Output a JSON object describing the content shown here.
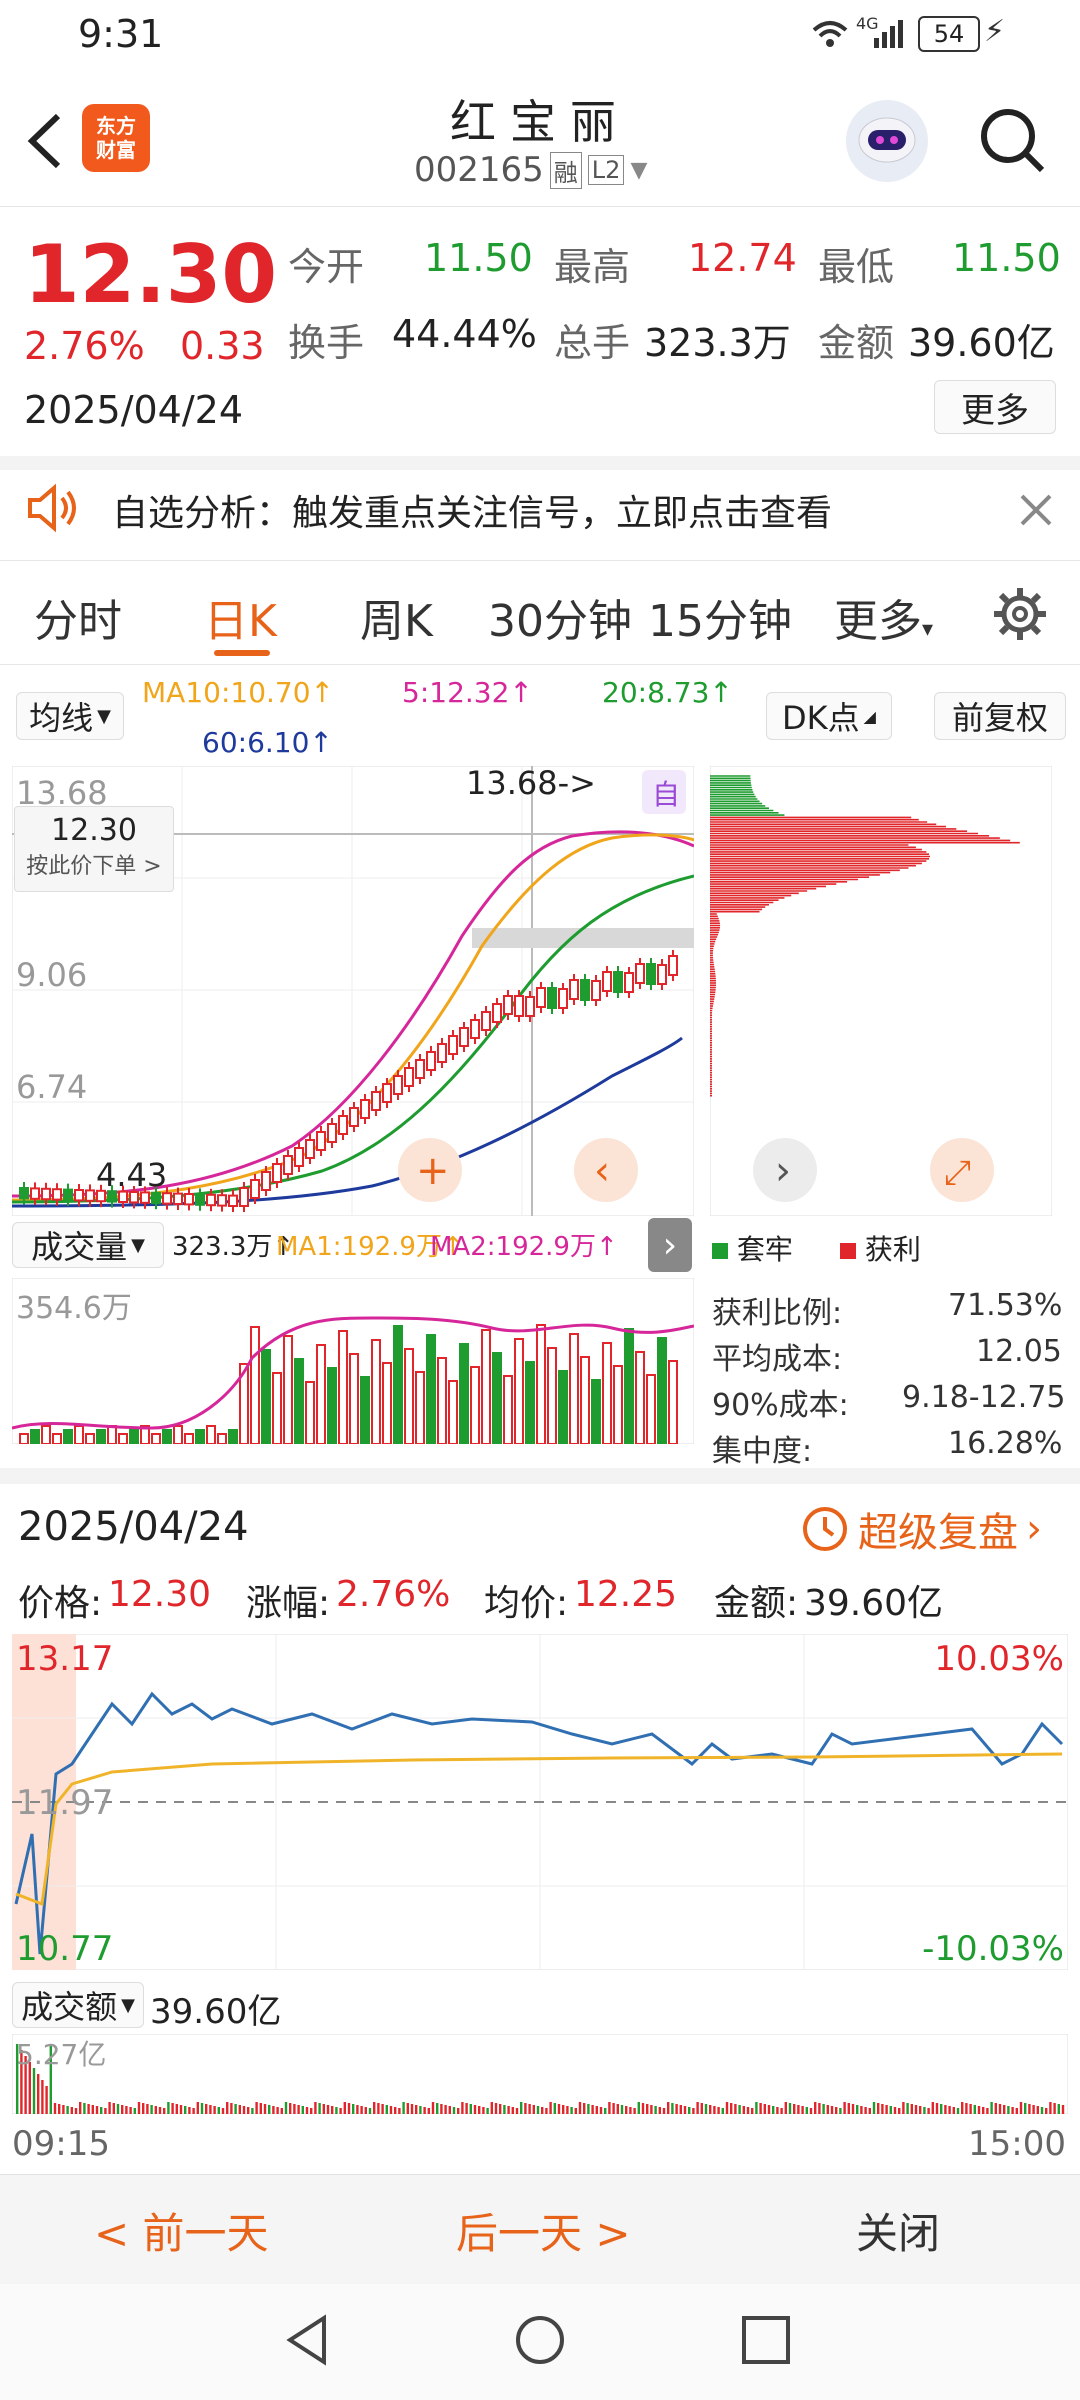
{
  "status_bar": {
    "time": "9:31",
    "network": "4G",
    "battery": "54"
  },
  "header": {
    "title": "红宝丽",
    "code": "002165",
    "badge_margin": "融",
    "badge_level": "L2",
    "logo_line1": "东方",
    "logo_line2": "财富"
  },
  "quote": {
    "price": "12.30",
    "change_pct": "2.76%",
    "change": "0.33",
    "date": "2025/04/24",
    "open_label": "今开",
    "open": "11.50",
    "high_label": "最高",
    "high": "12.74",
    "low_label": "最低",
    "low": "11.50",
    "turnover_label": "换手",
    "turnover": "44.44%",
    "volume_label": "总手",
    "volume": "323.3万",
    "amount_label": "金额",
    "amount": "39.60亿",
    "more_label": "更多"
  },
  "banner": {
    "text": "自选分析：触发重点关注信号，立即点击查看"
  },
  "tabs": [
    {
      "label": "分时"
    },
    {
      "label": "日K"
    },
    {
      "label": "周K"
    },
    {
      "label": "30分钟"
    },
    {
      "label": "15分钟"
    },
    {
      "label": "更多"
    }
  ],
  "kline": {
    "ma_selector": "均线",
    "ma10": "MA10:10.70↑",
    "ma5": "5:12.32↑",
    "ma20": "20:8.73↑",
    "ma60": "60:6.10↑",
    "dk_label": "DK点",
    "adjust_label": "前复权",
    "price_labels": [
      "13.68",
      "9.06",
      "6.74"
    ],
    "low_marker": "4.43",
    "high_marker": "13.68->",
    "self_tag": "自",
    "crosshair_price": "12.30",
    "crosshair_action": "按此价下单 >",
    "vol_selector": "成交量",
    "vol_value": "323.3万↑",
    "vol_ma1": "MA1:192.9万↑",
    "vol_ma2": "MA2:192.9万↑",
    "vol_max": "354.6万",
    "colors": {
      "up": "#e0262b",
      "down": "#1e9c2f",
      "ma5": "#d6279a",
      "ma10": "#f0a51a",
      "ma20": "#1e9c2f",
      "ma60": "#1d3a9c"
    }
  },
  "chip": {
    "legend_trapped": "套牢",
    "legend_profit": "获利",
    "rows": [
      {
        "label": "获利比例:",
        "value": "71.53%"
      },
      {
        "label": "平均成本:",
        "value": "12.05"
      },
      {
        "label": "90%成本:",
        "value": "9.18-12.75"
      },
      {
        "label": "集中度:",
        "value": "16.28%"
      }
    ]
  },
  "intraday": {
    "date": "2025/04/24",
    "replay_label": "超级复盘",
    "price_label": "价格:",
    "price": "12.30",
    "pct_label": "涨幅:",
    "pct": "2.76%",
    "avg_label": "均价:",
    "avg": "12.25",
    "amount_label": "金额:",
    "amount": "39.60亿",
    "top_price": "13.17",
    "top_pct": "10.03%",
    "mid_price": "11.97",
    "bottom_price": "10.77",
    "bottom_pct": "-10.03%",
    "amount_selector": "成交额",
    "amount_total": "39.60亿",
    "amount_max": "5.27亿",
    "time_start": "09:15",
    "time_end": "15:00"
  },
  "footer": {
    "prev_day": "< 前一天",
    "next_day": "后一天 >",
    "close": "关闭"
  }
}
